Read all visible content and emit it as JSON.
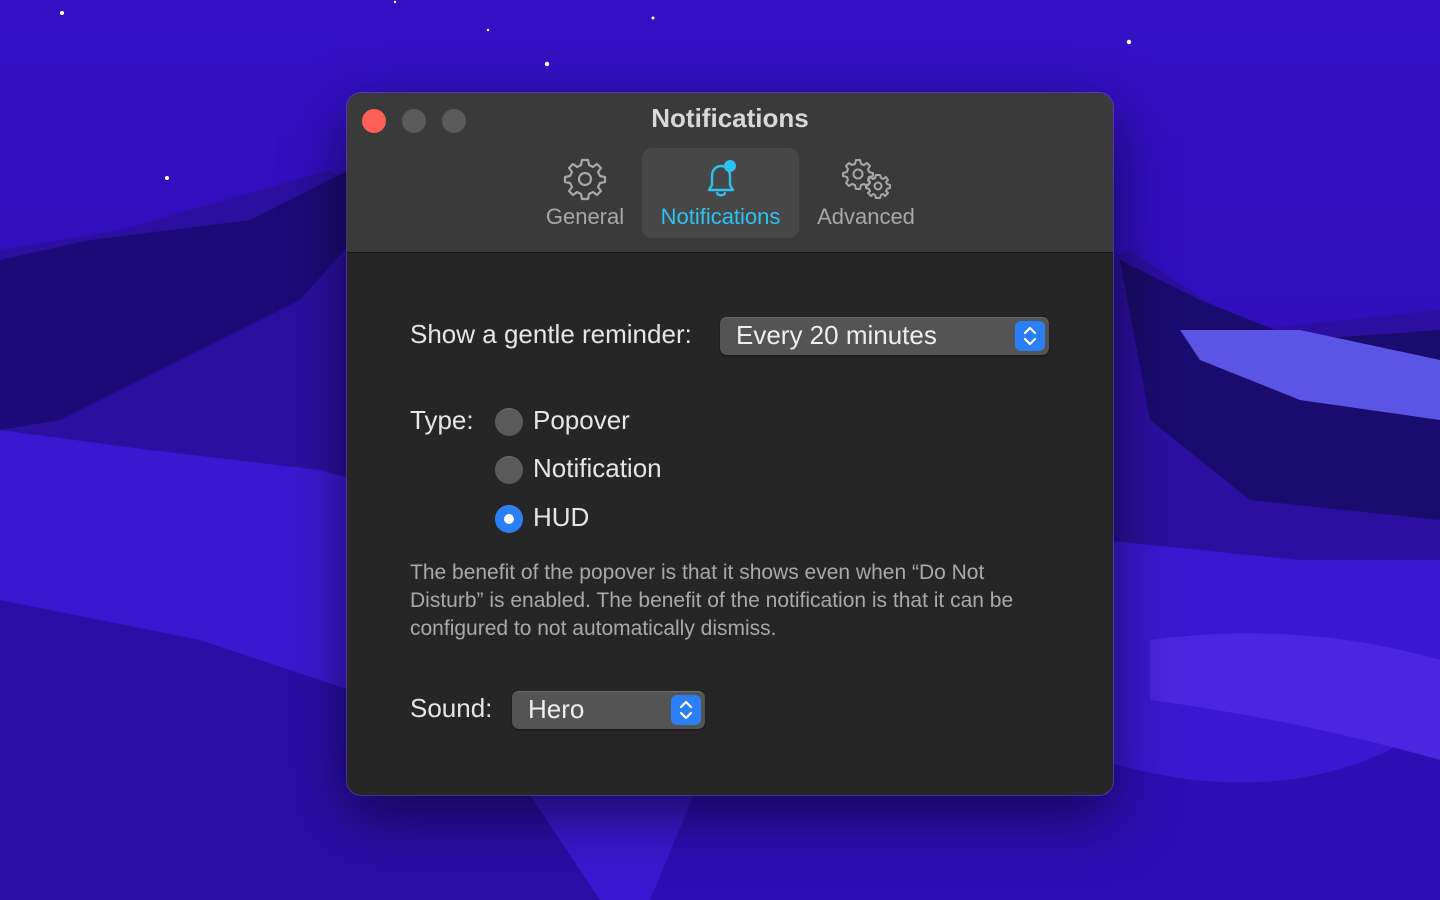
{
  "window": {
    "title": "Notifications"
  },
  "toolbar": {
    "tabs": [
      {
        "label": "General",
        "icon": "gear-icon",
        "selected": false
      },
      {
        "label": "Notifications",
        "icon": "bell-badge-icon",
        "selected": true
      },
      {
        "label": "Advanced",
        "icon": "gears-icon",
        "selected": false
      }
    ]
  },
  "reminder": {
    "label": "Show a gentle reminder:",
    "value": "Every 20 minutes"
  },
  "type": {
    "label": "Type:",
    "options": [
      {
        "label": "Popover",
        "checked": false
      },
      {
        "label": "Notification",
        "checked": false
      },
      {
        "label": "HUD",
        "checked": true
      }
    ]
  },
  "help_text": "The benefit of the popover is that it shows even when “Do Not Disturb” is enabled. The benefit of the notification is that it can be configured to not automatically dismiss.",
  "sound": {
    "label": "Sound:",
    "value": "Hero"
  },
  "colors": {
    "accent": "#2b7ff6",
    "selected_tab_text": "#2cc2f2",
    "close_button": "#ff5f57",
    "window_background": "#262626",
    "titlebar_background": "#3a3a3a"
  }
}
